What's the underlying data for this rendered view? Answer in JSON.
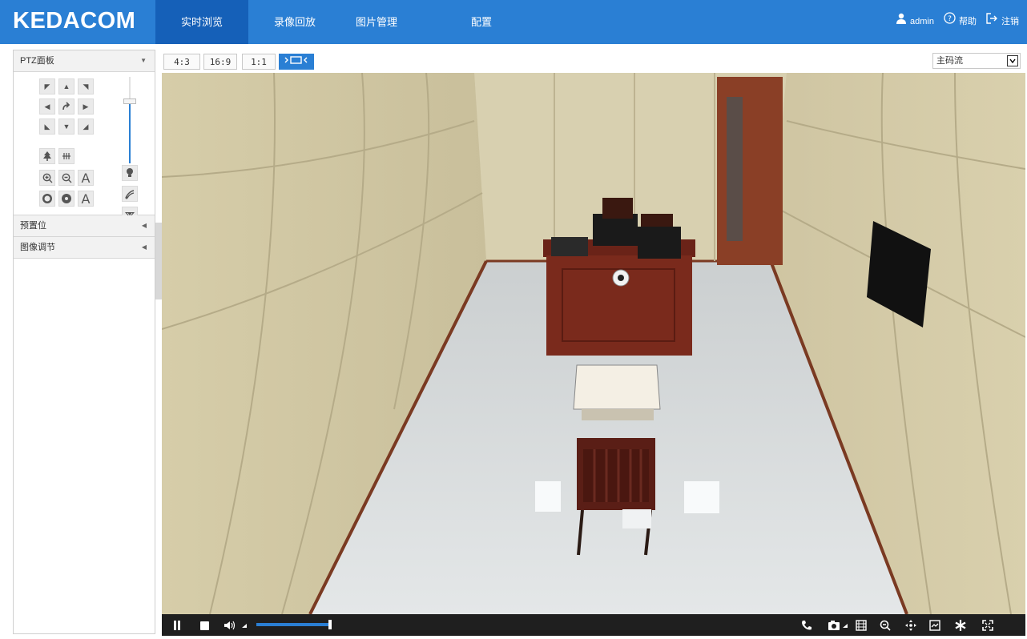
{
  "header": {
    "logo": "KEDACOM",
    "tabs": [
      {
        "label": "实时浏览",
        "active": true
      },
      {
        "label": "录像回放",
        "active": false
      },
      {
        "label": "图片管理",
        "active": false
      },
      {
        "label": "配置",
        "active": false
      }
    ],
    "user": "admin",
    "help_label": "帮助",
    "logout_label": "注销"
  },
  "left_panel": {
    "ptz_title": "PTZ面板",
    "focus_label_letter": "A",
    "iris_label_letter": "A",
    "sections": [
      "预置位",
      "图像调节"
    ],
    "speed_level_fraction": 0.72
  },
  "toolbar": {
    "ratios": [
      "4:3",
      "16:9",
      "1:1"
    ],
    "stream_value": "主码流"
  },
  "playback": {
    "volume_fraction": 1.0
  },
  "colors": {
    "brand_blue": "#2a7fd4",
    "active_tab": "#1560b8",
    "bar_dark": "#1f1f1f"
  },
  "icons": {
    "toolbar": [
      "pause-icon",
      "stop-icon",
      "volume-icon",
      "talk-icon",
      "snapshot-icon",
      "record-icon",
      "zoom-icon",
      "ptz-move-icon",
      "region-icon",
      "star-icon",
      "fullscreen-icon"
    ]
  }
}
